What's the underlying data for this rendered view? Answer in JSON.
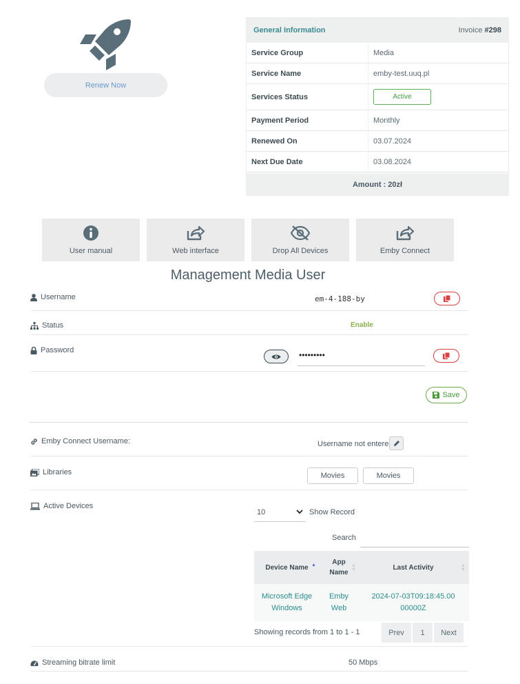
{
  "renew": {
    "label": "Renew Now"
  },
  "info": {
    "title": "General Information",
    "invoice_prefix": "Invoice",
    "invoice_number": "#298",
    "rows": [
      {
        "key": "Service Group",
        "value": "Media"
      },
      {
        "key": "Service Name",
        "value": "emby-test.uuq.pl"
      },
      {
        "key": "Services Status",
        "value": "Active"
      },
      {
        "key": "Payment Period",
        "value": "Monthly"
      },
      {
        "key": "Renewed On",
        "value": "03.07.2024"
      },
      {
        "key": "Next Due Date",
        "value": "03.08.2024"
      }
    ],
    "amount": "Amount : 20zł"
  },
  "tiles": [
    {
      "label": "User manual",
      "icon": "info-icon"
    },
    {
      "label": "Web interface",
      "icon": "share-icon"
    },
    {
      "label": "Drop All Devices",
      "icon": "eye-slash-icon"
    },
    {
      "label": "Emby Connect",
      "icon": "share-icon"
    }
  ],
  "management": {
    "title": "Management Media User",
    "username_label": "Username",
    "username_value": "em-4-188-by",
    "status_label": "Status",
    "status_value": "Enable",
    "password_label": "Password",
    "password_value": "•••••••••",
    "save_label": "Save",
    "emby_connect_label": "Emby Connect Username:",
    "emby_connect_value": "Username not entered",
    "libraries_label": "Libraries",
    "libraries": [
      "Movies",
      "Movies"
    ],
    "active_devices_label": "Active Devices",
    "records_select": "10",
    "show_record_label": "Show Record",
    "search_label": "Search",
    "table": {
      "headers": [
        "Device Name",
        "App Name",
        "Last Activity"
      ],
      "rows": [
        {
          "device": "Microsoft Edge Windows",
          "app": "Emby Web",
          "activity": "2024-07-03T09:18:45.0000000Z"
        }
      ]
    },
    "showing_text": "Showing records from 1 to 1 - 1",
    "pager": {
      "prev": "Prev",
      "page": "1",
      "next": "Next"
    },
    "bitrate_label": "Streaming bitrate limit",
    "bitrate_value": "50 Mbps"
  },
  "colors": {
    "accent_teal": "#2c8c8c",
    "active_green": "#3f9a3f",
    "danger_red": "#d94040",
    "icon_slate": "#5a6e7a"
  }
}
